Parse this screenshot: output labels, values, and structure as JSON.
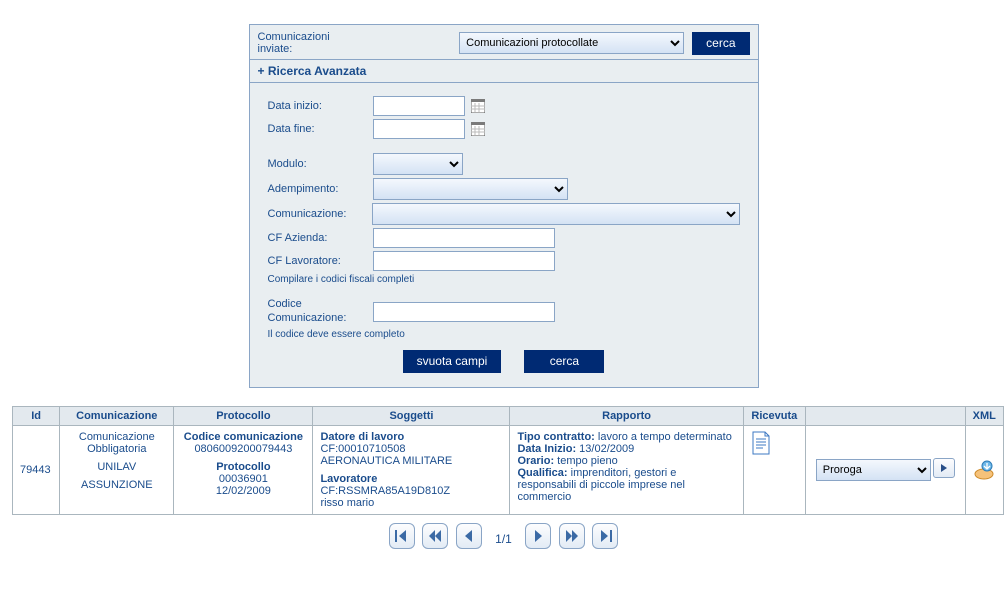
{
  "header": {
    "label_comunicazioni_inviate": "Comunicazioni\ninviate:",
    "select_value": "Comunicazioni protocollate",
    "btn_cerca": "cerca"
  },
  "adv": {
    "title": "+ Ricerca Avanzata",
    "lab_data_inizio": "Data inizio:",
    "lab_data_fine": "Data fine:",
    "lab_modulo": "Modulo:",
    "lab_adempimento": "Adempimento:",
    "lab_comunicazione": "Comunicazione:",
    "lab_cf_azienda": "CF Azienda:",
    "lab_cf_lavoratore": "CF Lavoratore:",
    "hint_cf": "Compilare i codici fiscali completi",
    "lab_codice_com": "Codice Comunicazione:",
    "hint_codice": "Il codice deve essere completo",
    "btn_svuota": "svuota campi",
    "btn_cerca": "cerca"
  },
  "table": {
    "headers": {
      "id": "Id",
      "comunicazione": "Comunicazione",
      "protocollo": "Protocollo",
      "soggetti": "Soggetti",
      "rapporto": "Rapporto",
      "ricevuta": "Ricevuta",
      "action": "",
      "xml": "XML"
    },
    "rows": [
      {
        "id": "79443",
        "comunicazione_l1": "Comunicazione Obbligatoria",
        "comunicazione_l2": "UNILAV",
        "comunicazione_l3": "ASSUNZIONE",
        "prot_l1": "Codice comunicazione",
        "prot_l2": "0806009200079443",
        "prot_l3": "Protocollo",
        "prot_l4": "00036901",
        "prot_l5": "12/02/2009",
        "sogg_d_lab": "Datore di lavoro",
        "sogg_d_cf": "CF:00010710508",
        "sogg_d_name": "AERONAUTICA MILITARE",
        "sogg_l_lab": "Lavoratore",
        "sogg_l_cf": "CF:RSSMRA85A19D810Z",
        "sogg_l_name": "risso mario",
        "rap_tipo_lab": "Tipo contratto:",
        "rap_tipo_val": " lavoro a tempo determinato",
        "rap_inizio_lab": "Data Inizio:",
        "rap_inizio_val": " 13/02/2009",
        "rap_orario_lab": "Orario:",
        "rap_orario_val": " tempo pieno",
        "rap_qual_lab": "Qualifica:",
        "rap_qual_val": " imprenditori, gestori e responsabili di piccole imprese nel commercio",
        "action_select": "Proroga"
      }
    ]
  },
  "pager": {
    "indicator": "1/1"
  }
}
